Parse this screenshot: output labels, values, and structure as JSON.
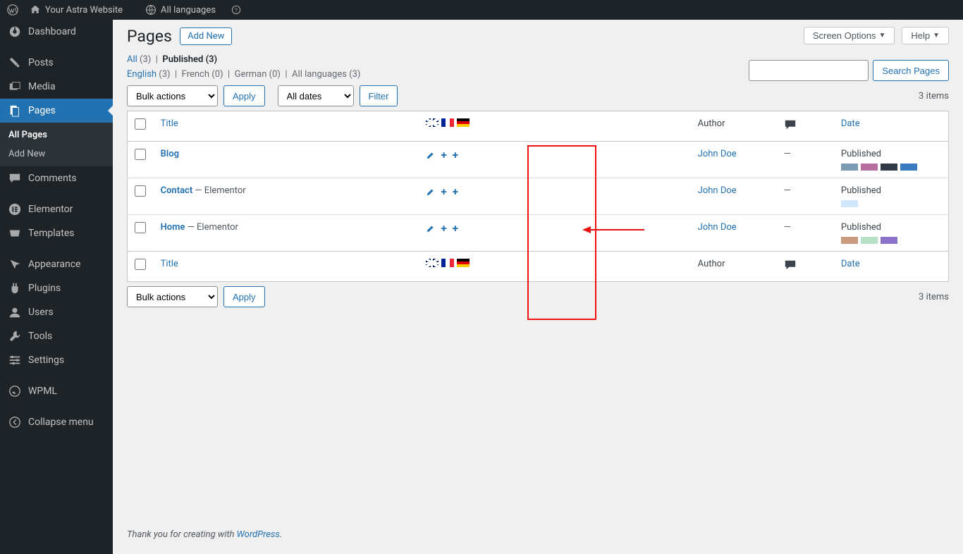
{
  "topbar": {
    "site": "Your Astra Website",
    "lang": "All languages"
  },
  "sidebar": {
    "items": [
      {
        "label": "Dashboard"
      },
      {
        "label": "Posts"
      },
      {
        "label": "Media"
      },
      {
        "label": "Pages"
      },
      {
        "label": "Comments"
      },
      {
        "label": "Elementor"
      },
      {
        "label": "Templates"
      },
      {
        "label": "Appearance"
      },
      {
        "label": "Plugins"
      },
      {
        "label": "Users"
      },
      {
        "label": "Tools"
      },
      {
        "label": "Settings"
      },
      {
        "label": "WPML"
      },
      {
        "label": "Collapse menu"
      }
    ],
    "sub": {
      "all": "All Pages",
      "add": "Add New"
    }
  },
  "header": {
    "title": "Pages",
    "add_new": "Add New",
    "screen_options": "Screen Options",
    "help": "Help"
  },
  "filters": {
    "all": "All",
    "all_count": "(3)",
    "published": "Published",
    "published_count": "(3)",
    "english": "English",
    "english_count": "(3)",
    "french": "French",
    "french_count": "(0)",
    "german": "German",
    "german_count": "(0)",
    "all_lang": "All languages",
    "all_lang_count": "(3)"
  },
  "actions": {
    "bulk": "Bulk actions",
    "apply": "Apply",
    "dates": "All dates",
    "filter": "Filter",
    "search": "Search Pages",
    "items": "3 items"
  },
  "columns": {
    "title": "Title",
    "author": "Author",
    "date": "Date"
  },
  "rows": [
    {
      "title": "Blog",
      "suffix": "",
      "author": "John Doe",
      "comments": "—",
      "status": "Published",
      "swatches": [
        "#7b9bb3",
        "#b76fa0",
        "#323a45",
        "#3a7bbf"
      ]
    },
    {
      "title": "Contact",
      "suffix": " — Elementor",
      "author": "John Doe",
      "comments": "—",
      "status": "Published",
      "swatches": [
        "#cfe6fb"
      ]
    },
    {
      "title": "Home",
      "suffix": " — Elementor",
      "author": "John Doe",
      "comments": "—",
      "status": "Published",
      "swatches": [
        "#c99b7e",
        "#b8e0c9",
        "#8a72c9"
      ]
    }
  ],
  "footer": {
    "prefix": "Thank you for creating with ",
    "link": "WordPress",
    "suffix": "."
  }
}
